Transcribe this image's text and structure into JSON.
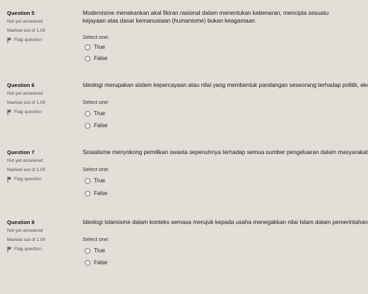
{
  "questions": [
    {
      "number": "Question 5",
      "state": "Not yet answered",
      "mark": "Marked out of 1.00",
      "flag": "Flag question",
      "text": "Modernisme menekankan akal fikiran rasional dalam menentukan kebenaran, mencipta sesuatu kejayaan atas dasar kemanusiaan (humanisme) bukan keagamaan.",
      "select_label": "Select one:",
      "options": [
        "True",
        "False"
      ]
    },
    {
      "number": "Question 6",
      "state": "Not yet answered",
      "mark": "Marked out of 1.00",
      "flag": "Flag question",
      "text": "Ideologi merupakan sistem kepercayaan atau nilai yang membentuk pandangan seseorang terhadap politik, ekon",
      "select_label": "Select one:",
      "options": [
        "True",
        "False"
      ]
    },
    {
      "number": "Question 7",
      "state": "Not yet answered",
      "mark": "Marked out of 1.00",
      "flag": "Flag question",
      "text": "Sosialisme menyokong pemilikan swasta sepenuhnya terhadap semua sumber pengeluaran dalam masyarakat.",
      "select_label": "Select one:",
      "options": [
        "True",
        "False"
      ]
    },
    {
      "number": "Question 8",
      "state": "Not yet answered",
      "mark": "Marked out of 1.00",
      "flag": "Flag question",
      "text": "Ideologi Islamisme dalam konteks semasa merujuk kepada usaha menegakkan nilai Islam dalam pemerintahan",
      "select_label": "Select one:",
      "options": [
        "True",
        "False"
      ]
    }
  ]
}
